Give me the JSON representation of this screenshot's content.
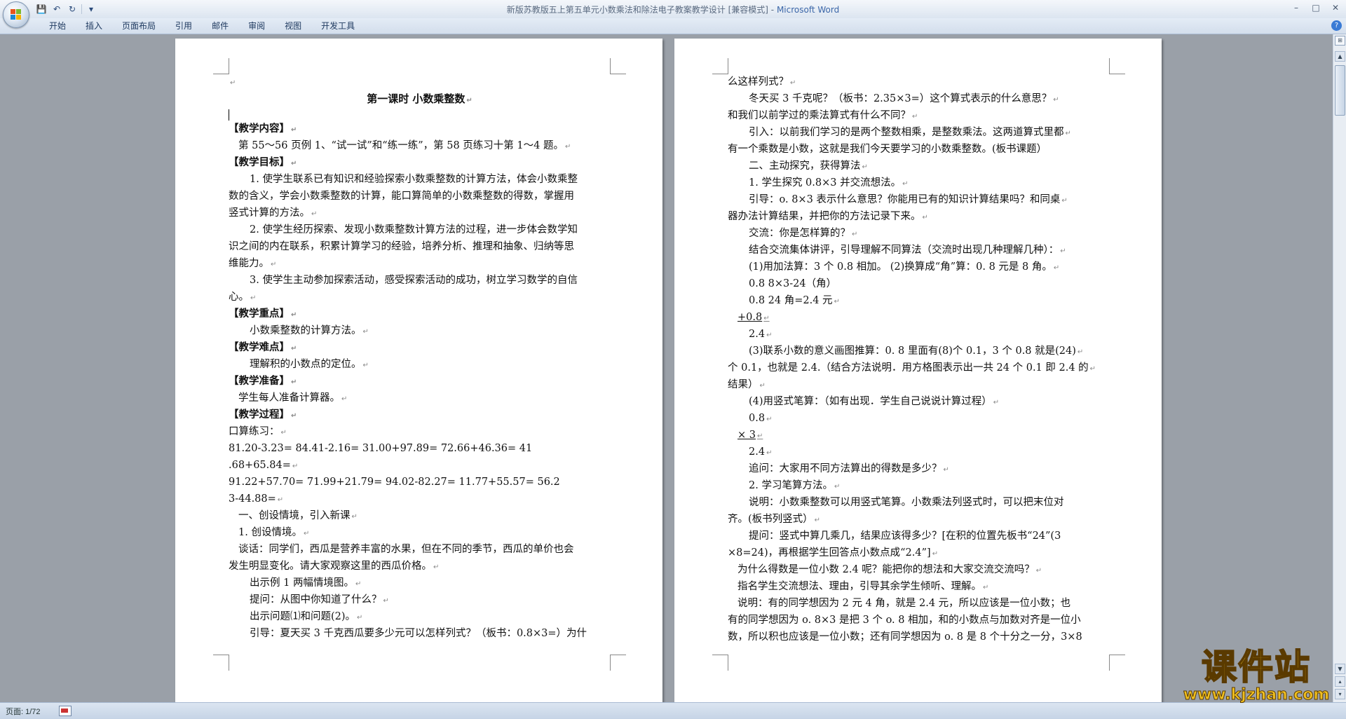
{
  "window": {
    "title": "新版苏教版五上第五单元小数乘法和除法电子教案教学设计 [兼容模式]",
    "app_name": "Microsoft Word",
    "title_separator": " - "
  },
  "quick_access": {
    "save_icon": "💾",
    "undo_icon": "↶",
    "redo_icon": "↻",
    "customize_icon": "▾"
  },
  "window_controls": {
    "minimize": "–",
    "maximize": "□",
    "close": "✕"
  },
  "ribbon": {
    "tabs": [
      "开始",
      "插入",
      "页面布局",
      "引用",
      "邮件",
      "审阅",
      "视图",
      "开发工具"
    ],
    "help_icon": "?"
  },
  "pilcrow": "↵",
  "page_left": {
    "lines": [
      {
        "t": "",
        "c": "",
        "pm": true
      },
      {
        "t": "第一课时  小数乘整数",
        "c": "title",
        "pm": true
      },
      {
        "t": "",
        "c": "cursor",
        "pm": false
      },
      {
        "t": "【教学内容】",
        "c": "b",
        "pm": true
      },
      {
        "t": "第 55～56 页例 1、“试一试”和“练一练”，第 58 页练习十第 1～4 题。",
        "c": "i1",
        "pm": true
      },
      {
        "t": "【教学目标】",
        "c": "b",
        "pm": true
      },
      {
        "t": "1. 使学生联系已有知识和经验探索小数乘整数的计算方法，体会小数乘整",
        "c": "i2",
        "pm": false
      },
      {
        "t": "数的含义，学会小数乘整数的计算，能口算简单的小数乘整数的得数，掌握用",
        "c": "",
        "pm": false
      },
      {
        "t": "竖式计算的方法。",
        "c": "",
        "pm": true
      },
      {
        "t": "2. 使学生经历探索、发现小数乘整数计算方法的过程，进一步体会数学知",
        "c": "i2",
        "pm": false
      },
      {
        "t": "识之间的内在联系，积累计算学习的经验，培养分析、推理和抽象、归纳等思",
        "c": "",
        "pm": false
      },
      {
        "t": "维能力。",
        "c": "",
        "pm": true
      },
      {
        "t": "3. 使学生主动参加探索活动，感受探索活动的成功，树立学习数学的自信",
        "c": "i2",
        "pm": false
      },
      {
        "t": "心。",
        "c": "",
        "pm": true
      },
      {
        "t": "【教学重点】",
        "c": "b",
        "pm": true
      },
      {
        "t": "小数乘整数的计算方法。",
        "c": "i2",
        "pm": true
      },
      {
        "t": "【教学难点】",
        "c": "b",
        "pm": true
      },
      {
        "t": "理解积的小数点的定位。",
        "c": "i2",
        "pm": true
      },
      {
        "t": "【教学准备】",
        "c": "b",
        "pm": true
      },
      {
        "t": "学生每人准备计算器。",
        "c": "i1",
        "pm": true
      },
      {
        "t": "【教学过程】",
        "c": "b",
        "pm": true
      },
      {
        "t": "口算练习：",
        "c": "",
        "pm": true
      },
      {
        "t": "81.20-3.23=     84.41-2.16=       31.00+97.89=       72.66+46.36=     41",
        "c": "",
        "pm": false
      },
      {
        "t": ".68+65.84=",
        "c": "",
        "pm": true
      },
      {
        "t": "91.22+57.70=     71.99+21.79=     94.02-82.27=     11.77+55.57=     56.2",
        "c": "",
        "pm": false
      },
      {
        "t": "3-44.88=",
        "c": "",
        "pm": true
      },
      {
        "t": "一、创设情境，引入新课",
        "c": "i1",
        "pm": true
      },
      {
        "t": "1. 创设情境。",
        "c": "i1",
        "pm": true
      },
      {
        "t": "谈话：同学们，西瓜是营养丰富的水果，但在不同的季节，西瓜的单价也会",
        "c": "i1",
        "pm": false
      },
      {
        "t": "发生明显变化。请大家观察这里的西瓜价格。",
        "c": "",
        "pm": true
      },
      {
        "t": "出示例 1 两幅情境图。",
        "c": "i2",
        "pm": true
      },
      {
        "t": "提问：从图中你知道了什么？",
        "c": "i2",
        "pm": true
      },
      {
        "t": "出示问题⑴和问题(2)。",
        "c": "i2",
        "pm": true
      },
      {
        "t": "引导：夏天买 3 千克西瓜要多少元可以怎样列式？（板书：0.8×3=）为什",
        "c": "i2",
        "pm": false
      }
    ]
  },
  "page_right": {
    "lines": [
      {
        "t": "么这样列式？",
        "c": "",
        "pm": true
      },
      {
        "t": "冬天买 3 千克呢？（板书：2.35×3=）这个算式表示的什么意思？",
        "c": "i2",
        "pm": true
      },
      {
        "t": "和我们以前学过的乘法算式有什么不同？",
        "c": "",
        "pm": true
      },
      {
        "t": "引入：以前我们学习的是两个整数相乘，是整数乘法。这两道算式里都",
        "c": "i2",
        "pm": true
      },
      {
        "t": "有一个乘数是小数，这就是我们今天要学习的小数乘整数。(板书课题）",
        "c": "",
        "pm": false
      },
      {
        "t": "二、主动探究，获得算法",
        "c": "i2",
        "pm": true
      },
      {
        "t": "1. 学生探究 0.8×3 并交流想法。",
        "c": "i2",
        "pm": true
      },
      {
        "t": "引导：o. 8×3 表示什么意思？你能用已有的知识计算结果吗？和同桌",
        "c": "i2",
        "pm": true
      },
      {
        "t": "器办法计算结果，并把你的方法记录下来。",
        "c": "",
        "pm": true
      },
      {
        "t": "交流：你是怎样算的？",
        "c": "i2",
        "pm": true
      },
      {
        "t": "结合交流集体讲评，引导理解不同算法（交流时出现几种理解几种）：",
        "c": "i2",
        "pm": true
      },
      {
        "t": "(1)用加法算：3 个 0.8 相加。      (2)换算成“角”算：0. 8 元是 8 角。",
        "c": "i2",
        "pm": true
      },
      {
        "t": "0.8                                          8×3-24（角）",
        "c": "i2",
        "pm": false
      },
      {
        "t": "0.8                                          24 角=2.4 元",
        "c": "i2",
        "pm": true
      },
      {
        "t": "+0.8",
        "c": "i1 u",
        "pm": true
      },
      {
        "t": "2.4",
        "c": "i2",
        "pm": true
      },
      {
        "t": "(3)联系小数的意义画图推算：0. 8 里面有(8)个 0.1，3 个 0.8 就是(24)",
        "c": "i2",
        "pm": true
      },
      {
        "t": "个 0.1，也就是 2.4.（结合方法说明．用方格图表示出一共 24 个 0.1 即 2.4 的",
        "c": "",
        "pm": true
      },
      {
        "t": "结果）",
        "c": "",
        "pm": true
      },
      {
        "t": "(4)用竖式笔算：（如有出现．学生自己说说计算过程）",
        "c": "i2",
        "pm": true
      },
      {
        "t": "     0.8",
        "c": "i2",
        "pm": true
      },
      {
        "t": "×      3",
        "c": "i1 u",
        "pm": true
      },
      {
        "t": "     2.4",
        "c": "i2",
        "pm": true
      },
      {
        "t": "追问：大家用不同方法算出的得数是多少？",
        "c": "i2",
        "pm": true
      },
      {
        "t": "2. 学习笔算方法。",
        "c": "i2",
        "pm": true
      },
      {
        "t": "说明：小数乘整数可以用竖式笔算。小数乘法列竖式时，可以把末位对",
        "c": "i2",
        "pm": false
      },
      {
        "t": "齐。(板书列竖式）",
        "c": "",
        "pm": true
      },
      {
        "t": "提问：竖式中算几乘几，结果应该得多少？[在积的位置先板书“24”(3",
        "c": "i2",
        "pm": false
      },
      {
        "t": "×8=24)，再根据学生回答点小数点成“2.4”]",
        "c": "",
        "pm": true
      },
      {
        "t": "为什么得数是一位小数 2.4 呢？能把你的想法和大家交流交流吗？",
        "c": "i1",
        "pm": true
      },
      {
        "t": "指名学生交流想法、理由，引导其余学生倾听、理解。",
        "c": "i1",
        "pm": true
      },
      {
        "t": "说明：有的同学想因为 2 元 4 角，就是 2.4 元，所以应该是一位小数；也",
        "c": "i1",
        "pm": false
      },
      {
        "t": "有的同学想因为 o. 8×3 是把 3 个 o. 8 相加，和的小数点与加数对齐是一位小",
        "c": "",
        "pm": false
      },
      {
        "t": "数，所以积也应该是一位小数；还有同学想因为 o. 8 是 8 个十分之一分，3×8",
        "c": "",
        "pm": false
      }
    ]
  },
  "statusbar": {
    "page": "页面: 1/72"
  },
  "watermark": {
    "main": "课件站",
    "url": "www.kjzhan.com"
  }
}
